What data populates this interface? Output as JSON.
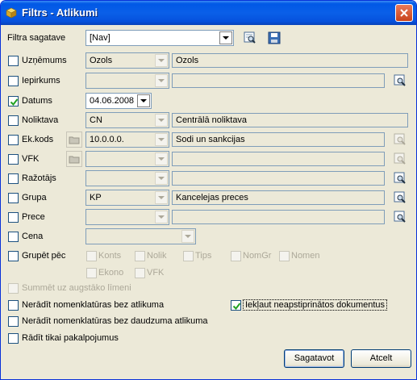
{
  "window": {
    "title": "Filtrs - Atlikumi"
  },
  "template": {
    "label": "Filtra sagatave",
    "value": "[Nav]"
  },
  "rows": {
    "uznemums": {
      "label": "Uzņēmums",
      "checked": false,
      "code": "Ozols",
      "name": "Ozols"
    },
    "iepirkums": {
      "label": "Iepirkums",
      "checked": false,
      "code": "",
      "name": ""
    },
    "datums": {
      "label": "Datums",
      "checked": true,
      "value": "04.06.2008"
    },
    "noliktava": {
      "label": "Noliktava",
      "checked": false,
      "code": "CN",
      "name": "Centrālā noliktava"
    },
    "ekkods": {
      "label": "Ek.kods",
      "checked": false,
      "code": "10.0.0.0.",
      "name": "Sodi un sankcijas"
    },
    "vfk": {
      "label": "VFK",
      "checked": false,
      "code": "",
      "name": ""
    },
    "razotajs": {
      "label": "Ražotājs",
      "checked": false,
      "code": "",
      "name": ""
    },
    "grupa": {
      "label": "Grupa",
      "checked": false,
      "code": "KP",
      "name": "Kancelejas preces"
    },
    "prece": {
      "label": "Prece",
      "checked": false,
      "code": "",
      "name": ""
    },
    "cena": {
      "label": "Cena",
      "checked": false,
      "value": ""
    }
  },
  "group_by": {
    "label": "Grupēt pēc",
    "options": [
      "Konts",
      "Nolik",
      "Tips",
      "NomGr",
      "Nomen",
      "Ekono",
      "VFK"
    ]
  },
  "options": {
    "summet": "Summēt uz augstāko līmeni",
    "bez_atlikuma": "Nerādīt nomenklatūras bez atlikuma",
    "bez_daudzuma": "Nerādīt nomenklatūras bez daudzuma atlikuma",
    "pakalpojumi": "Rādīt tikai pakalpojumus",
    "neapstiprinatos": "Iekļaut neapstiprinātos dokumentus"
  },
  "buttons": {
    "ok": "Sagatavot",
    "cancel": "Atcelt"
  },
  "colors": {
    "titlebar": "#0a5fe8",
    "window_bg": "#ece9d8",
    "field_border": "#7f9db9"
  }
}
